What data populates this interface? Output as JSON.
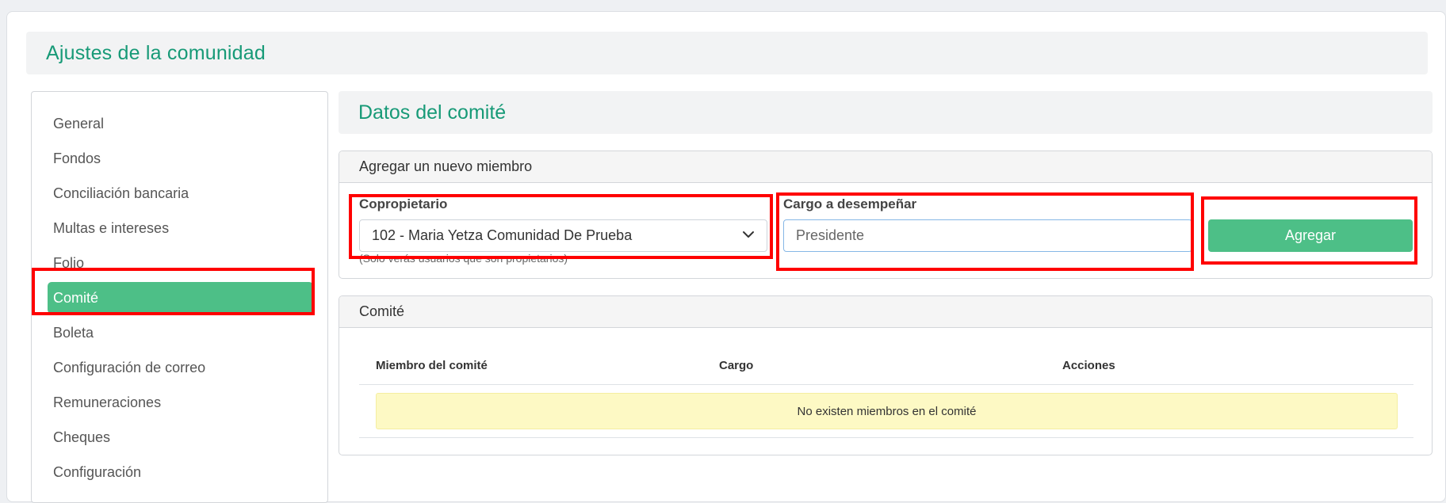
{
  "page": {
    "title": "Ajustes de la comunidad"
  },
  "sidebar": {
    "items": [
      {
        "label": "General"
      },
      {
        "label": "Fondos"
      },
      {
        "label": "Conciliación bancaria"
      },
      {
        "label": "Multas e intereses"
      },
      {
        "label": "Folio"
      },
      {
        "label": "Comité",
        "active": true
      },
      {
        "label": "Boleta"
      },
      {
        "label": "Configuración de correo"
      },
      {
        "label": "Remuneraciones"
      },
      {
        "label": "Cheques"
      },
      {
        "label": "Configuración"
      }
    ]
  },
  "section": {
    "title": "Datos del comité"
  },
  "add_member": {
    "heading": "Agregar un nuevo miembro",
    "owner_label": "Copropietario",
    "owner_value": "102 - Maria Yetza Comunidad De Prueba",
    "owner_help": "(Solo verás usuarios que son propietarios)",
    "role_label": "Cargo a desempeñar",
    "role_placeholder": "Presidente",
    "add_button": "Agregar"
  },
  "committee": {
    "heading": "Comité",
    "columns": [
      "Miembro del comité",
      "Cargo",
      "Acciones"
    ],
    "empty_message": "No existen miembros en el comité"
  },
  "colors": {
    "accent": "#179a77",
    "button": "#4dbf87",
    "highlight": "#ff0000",
    "empty_bg": "#fdf9c4"
  }
}
